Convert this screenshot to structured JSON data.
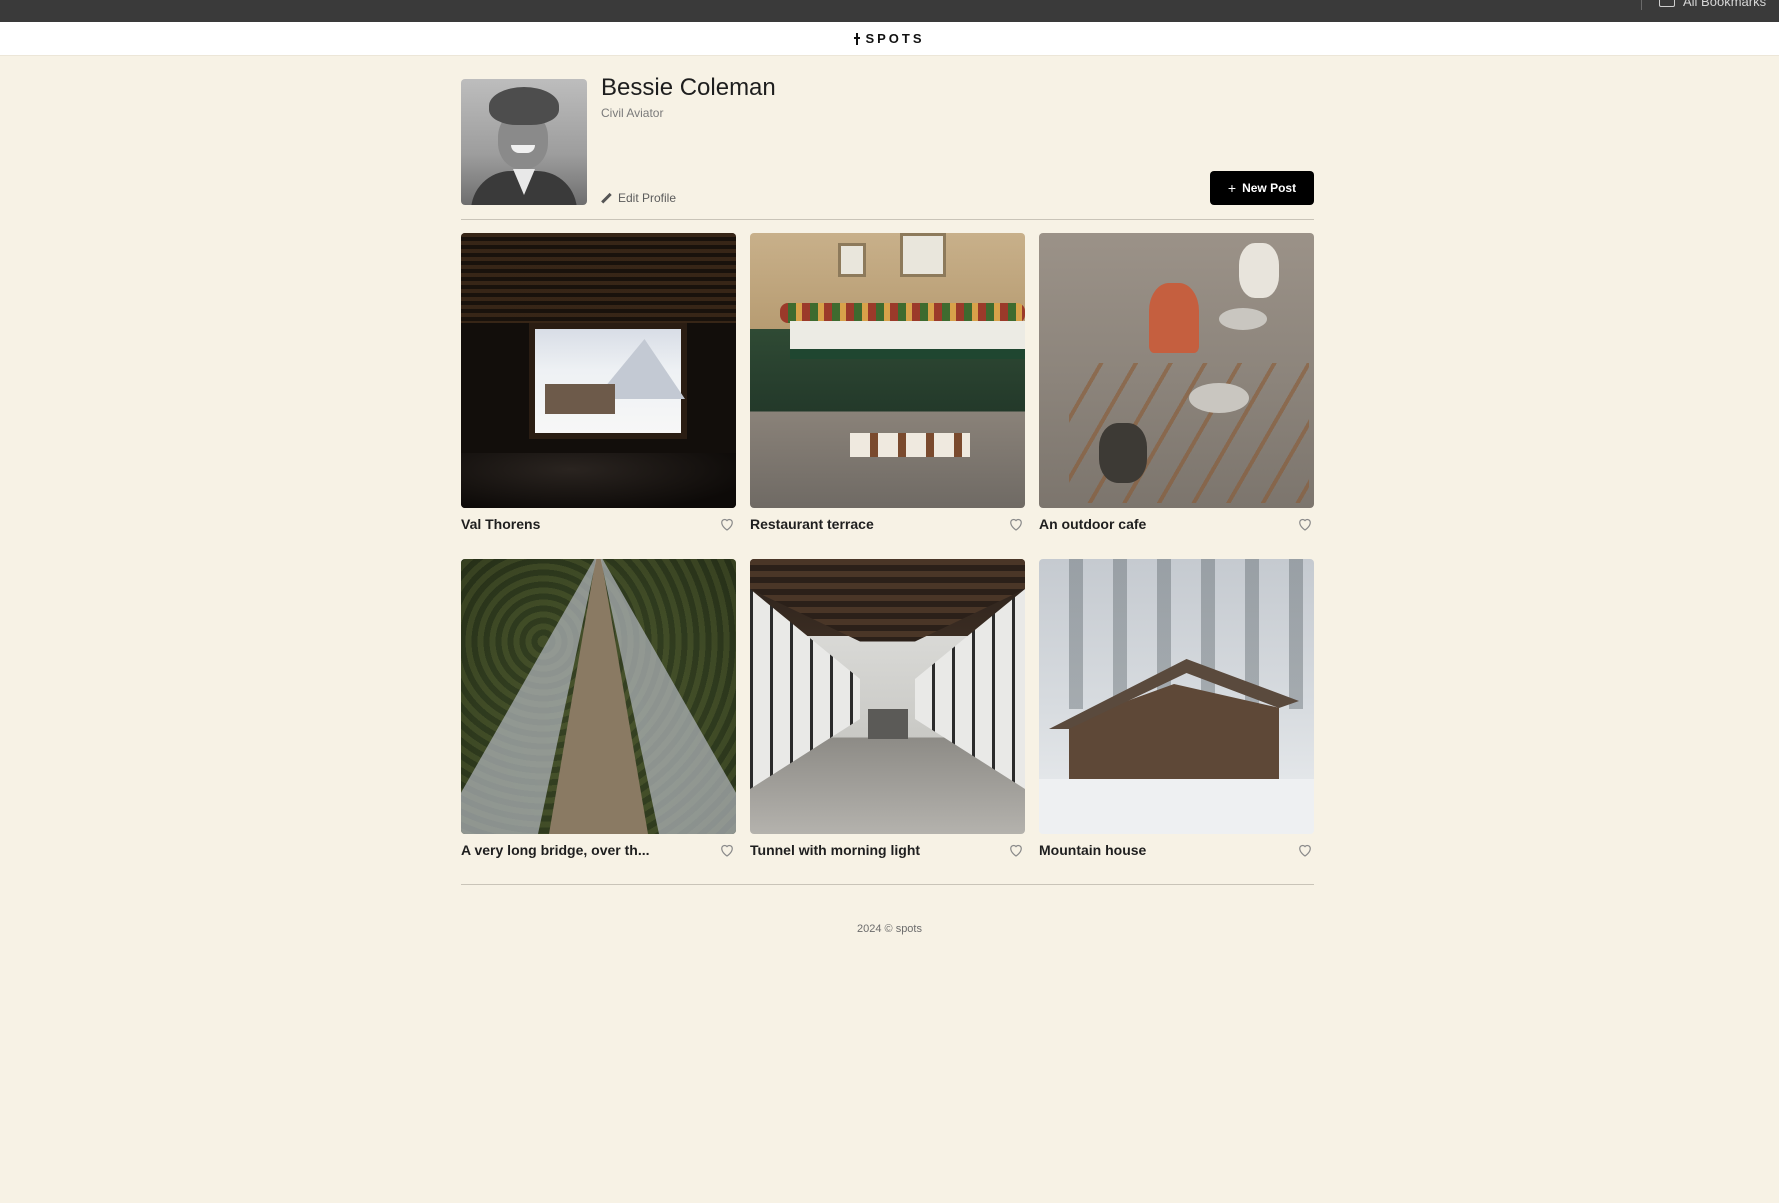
{
  "browser": {
    "bookmarks_label": "All Bookmarks"
  },
  "header": {
    "logo_text": "SPOTS"
  },
  "profile": {
    "name": "Bessie Coleman",
    "role": "Civil Aviator",
    "edit_label": "Edit Profile",
    "new_post_label": "New Post"
  },
  "cards": [
    {
      "title": "Val Thorens",
      "liked": false
    },
    {
      "title": "Restaurant terrace",
      "liked": false
    },
    {
      "title": "An outdoor cafe",
      "liked": false
    },
    {
      "title": "A very long bridge, over th...",
      "liked": false
    },
    {
      "title": "Tunnel with morning light",
      "liked": false
    },
    {
      "title": "Mountain house",
      "liked": false
    }
  ],
  "footer": {
    "text": "2024 © spots"
  },
  "colors": {
    "page_background": "#f7f2e5",
    "button_background": "#000000"
  }
}
